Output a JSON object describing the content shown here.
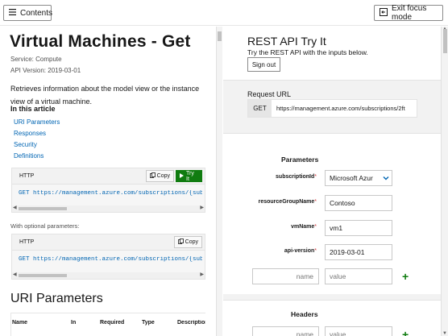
{
  "topbar": {
    "contents_label": "Contents",
    "exit_label": "Exit focus mode"
  },
  "article": {
    "title": "Virtual Machines - Get",
    "service": "Service:  Compute",
    "api_version": "API Version:  2019-03-01",
    "description": "Retrieves information about the model view or the instance view of a virtual machine.",
    "in_this_article": "In this article",
    "toc": [
      "URI Parameters",
      "Responses",
      "Security",
      "Definitions"
    ],
    "code1": {
      "lang": "HTTP",
      "copy": "Copy",
      "tryit": "Try It",
      "line": "GET https://management.azure.com/subscriptions/{subscriptionId}/resourceGroups/{resourceGroupName}/providers/Microsoft.Compute/virtualMachines/{vmName}?api-version=2019-03-01"
    },
    "optional_label": "With optional parameters:",
    "code2": {
      "lang": "HTTP",
      "copy": "Copy",
      "line": "GET https://management.azure.com/subscriptions/{subscriptionId}/resourceGroups/{resourceGroupName}/providers/Microsoft.Compute/virtualMachines/{vmName}?$expand=instanceView&api-version=2019-03-01"
    },
    "uri_heading": "URI Parameters",
    "table_headers": [
      "Name",
      "In",
      "Required",
      "Type",
      "Description"
    ]
  },
  "tryit": {
    "title": "REST API Try It",
    "subtitle": "Try the REST API with the inputs below.",
    "signout": "Sign out",
    "request_url_label": "Request URL",
    "method": "GET",
    "url": "https://management.azure.com/subscriptions/2ft",
    "parameters_title": "Parameters",
    "params": [
      {
        "name": "subscriptionId",
        "required": "*",
        "value": "Microsoft Azur"
      },
      {
        "name": "resourceGroupName",
        "required": "*",
        "value": "Contoso"
      },
      {
        "name": "vmName",
        "required": "*",
        "value": "vm1"
      },
      {
        "name": "api-version",
        "required": "*",
        "value": "2019-03-01"
      }
    ],
    "name_placeholder": "name",
    "value_placeholder": "value",
    "headers_title": "Headers"
  }
}
